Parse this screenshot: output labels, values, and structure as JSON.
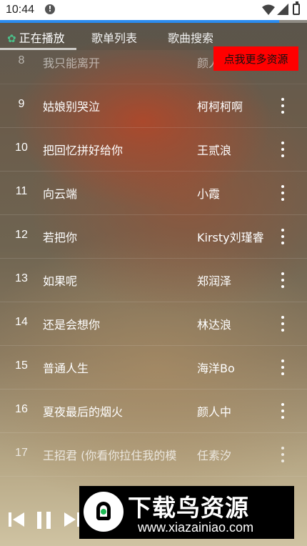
{
  "status_bar": {
    "time": "10:44",
    "alert_icon": "!"
  },
  "progress": {
    "value": 0.91
  },
  "tabs": [
    {
      "label": "正在播放",
      "icon": "clover-icon",
      "active": true
    },
    {
      "label": "歌单列表",
      "active": false
    },
    {
      "label": "歌曲搜索",
      "active": false
    }
  ],
  "promo": {
    "label": "点我更多资源"
  },
  "songs": [
    {
      "num": "8",
      "title": "我只能离开",
      "artist": "颜人中"
    },
    {
      "num": "9",
      "title": "姑娘别哭泣",
      "artist": "柯柯柯啊"
    },
    {
      "num": "10",
      "title": "把回忆拼好给你",
      "artist": "王贰浪"
    },
    {
      "num": "11",
      "title": "向云端",
      "artist": "小霞"
    },
    {
      "num": "12",
      "title": "若把你",
      "artist": "Kirsty刘瑾睿"
    },
    {
      "num": "13",
      "title": "如果呢",
      "artist": "郑润泽"
    },
    {
      "num": "14",
      "title": "还是会想你",
      "artist": "林达浪"
    },
    {
      "num": "15",
      "title": "普通人生",
      "artist": "海洋Bo"
    },
    {
      "num": "16",
      "title": "夏夜最后的烟火",
      "artist": "颜人中"
    },
    {
      "num": "17",
      "title": "王招君 (你看你拉住我的模",
      "artist": "任素汐"
    }
  ],
  "watermark": {
    "brand": "下载鸟资源",
    "url": "www.xiazainiao.com"
  },
  "colors": {
    "accent": "#2b8cf0",
    "promo_bg": "#ff0000",
    "clover": "#4bc08a"
  }
}
